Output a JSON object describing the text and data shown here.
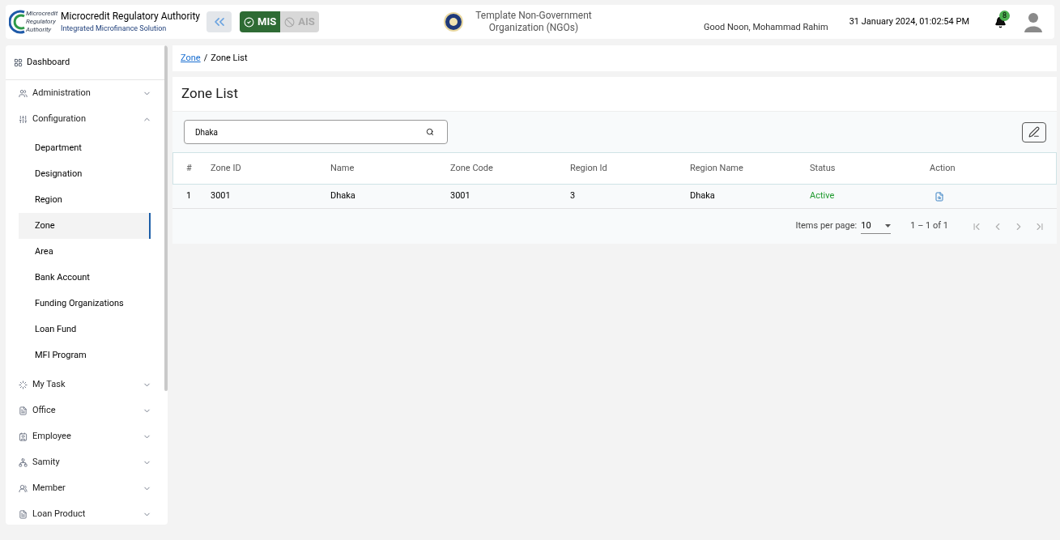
{
  "header": {
    "logo_text": [
      "Microcredit",
      "Regulatory",
      "Authority"
    ],
    "title": "Microcredit Regulatory Authority",
    "subtitle": "Integrated Microfinance Solution",
    "modes": [
      {
        "label": "MIS",
        "selected": true
      },
      {
        "label": "AIS",
        "selected": false
      }
    ],
    "org": "Template Non-Government Organization (NGOs)",
    "greeting": "Good Noon, Mohammad Rahim",
    "datetime": "31 January 2024, 01:02:54 PM",
    "notifications": "8"
  },
  "sidebar": {
    "dashboard": "Dashboard",
    "items": [
      {
        "label": "Administration",
        "expanded": false
      },
      {
        "label": "Configuration",
        "expanded": true,
        "children": [
          {
            "label": "Department",
            "selected": false
          },
          {
            "label": "Designation",
            "selected": false
          },
          {
            "label": "Region",
            "selected": false
          },
          {
            "label": "Zone",
            "selected": true
          },
          {
            "label": "Area",
            "selected": false
          },
          {
            "label": "Bank Account",
            "selected": false
          },
          {
            "label": "Funding Organizations",
            "selected": false
          },
          {
            "label": "Loan Fund",
            "selected": false
          },
          {
            "label": "MFI Program",
            "selected": false
          }
        ]
      },
      {
        "label": "My Task",
        "expanded": false
      },
      {
        "label": "Office",
        "expanded": false
      },
      {
        "label": "Employee",
        "expanded": false
      },
      {
        "label": "Samity",
        "expanded": false
      },
      {
        "label": "Member",
        "expanded": false
      },
      {
        "label": "Loan Product",
        "expanded": false
      }
    ]
  },
  "breadcrumb": {
    "link": "Zone",
    "separator": "/",
    "current": "Zone List"
  },
  "page_title": "Zone List",
  "search": {
    "value": "Dhaka"
  },
  "table": {
    "columns": [
      "#",
      "Zone ID",
      "Name",
      "Zone Code",
      "Region Id",
      "Region Name",
      "Status",
      "Action"
    ],
    "rows": [
      {
        "cells": [
          "1",
          "3001",
          "Dhaka",
          "3001",
          "3",
          "Dhaka"
        ],
        "status": "Active"
      }
    ]
  },
  "paginator": {
    "label": "Items per page:",
    "page_size": "10",
    "range": "1 – 1 of 1",
    "buttons": [
      {
        "kind": "first",
        "disabled": true
      },
      {
        "kind": "prev",
        "disabled": true
      },
      {
        "kind": "next",
        "disabled": true
      },
      {
        "kind": "last",
        "disabled": true
      }
    ]
  }
}
